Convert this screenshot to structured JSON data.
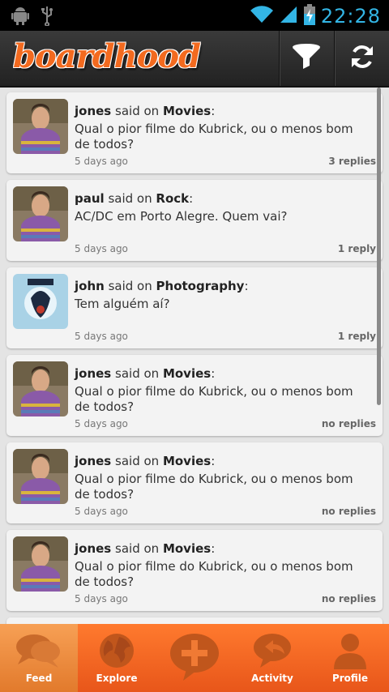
{
  "status_bar": {
    "time": "22:28"
  },
  "app": {
    "logo_text": "boardhood"
  },
  "feed": [
    {
      "user": "jones",
      "said_on": "said on",
      "board": "Movies",
      "message": "Qual o pior filme do Kubrick, ou o menos bom de todos?",
      "time": "5 days ago",
      "replies": "3 replies",
      "avatar": "person-avatar"
    },
    {
      "user": "paul",
      "said_on": "said on",
      "board": "Rock",
      "message": "AC/DC em Porto Alegre. Quem vai?",
      "time": "5 days ago",
      "replies": "1 reply",
      "avatar": "person-avatar"
    },
    {
      "user": "john",
      "said_on": "said on",
      "board": "Photography",
      "message": "Tem alguém aí?",
      "time": "5 days ago",
      "replies": "1 reply",
      "avatar": "art-avatar"
    },
    {
      "user": "jones",
      "said_on": "said on",
      "board": "Movies",
      "message": "Qual o pior filme do Kubrick, ou o menos bom de todos?",
      "time": "5 days ago",
      "replies": "no replies",
      "avatar": "person-avatar"
    },
    {
      "user": "jones",
      "said_on": "said on",
      "board": "Movies",
      "message": "Qual o pior filme do Kubrick, ou o menos bom de todos?",
      "time": "5 days ago",
      "replies": "no replies",
      "avatar": "person-avatar"
    },
    {
      "user": "jones",
      "said_on": "said on",
      "board": "Movies",
      "message": "Qual o pior filme do Kubrick, ou o menos bom de todos?",
      "time": "5 days ago",
      "replies": "no replies",
      "avatar": "person-avatar"
    }
  ],
  "tabs": [
    {
      "label": "Feed",
      "icon": "speech-bubbles-icon",
      "active": true
    },
    {
      "label": "Explore",
      "icon": "globe-icon",
      "active": false
    },
    {
      "label": "",
      "icon": "add-post-icon",
      "active": false
    },
    {
      "label": "Activity",
      "icon": "reply-bubble-icon",
      "active": false
    },
    {
      "label": "Profile",
      "icon": "person-icon",
      "active": false
    }
  ],
  "colors": {
    "accent": "#f36a1f",
    "status_blue": "#33b5e5",
    "tabbar": "#f06a24"
  }
}
